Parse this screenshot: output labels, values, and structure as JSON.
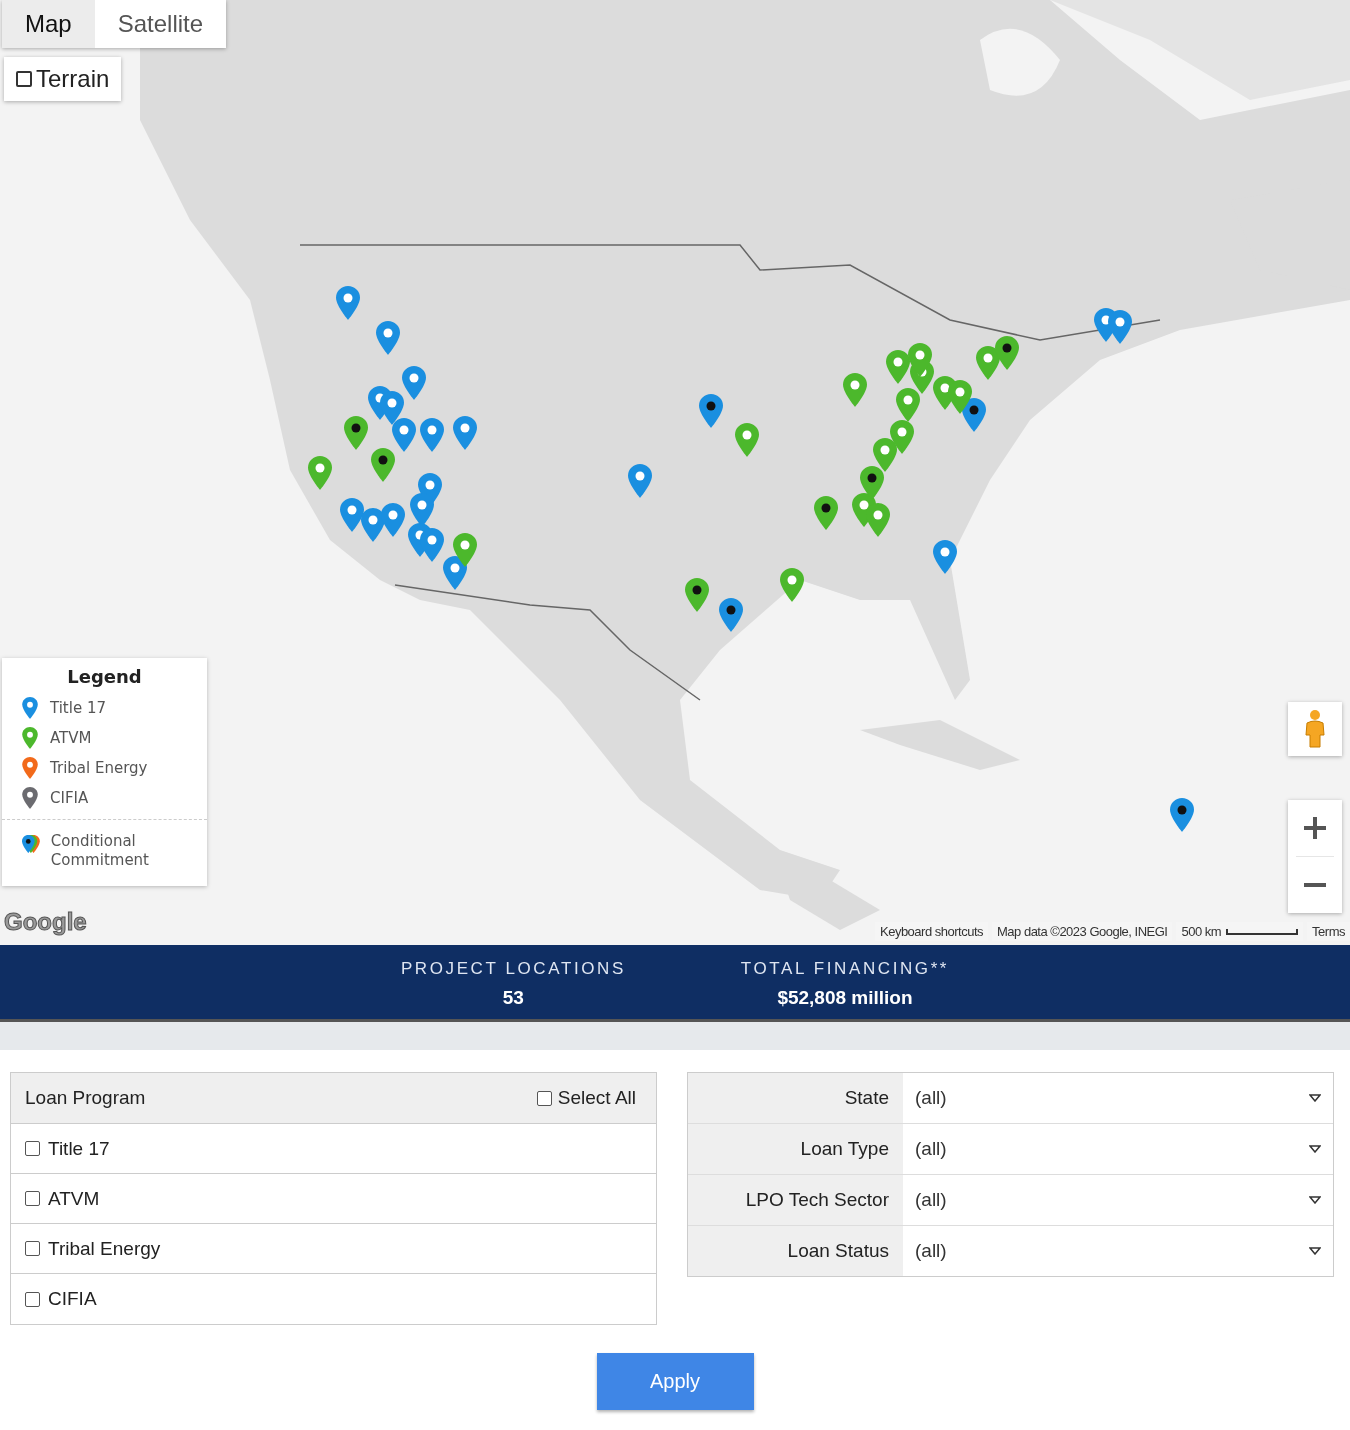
{
  "map": {
    "type_tabs": [
      {
        "label": "Map",
        "selected": true
      },
      {
        "label": "Satellite",
        "selected": false
      }
    ],
    "terrain": {
      "label": "Terrain",
      "checked": false
    },
    "legend": {
      "title": "Legend",
      "items": [
        {
          "label": "Title 17",
          "color": "#1a8fe0"
        },
        {
          "label": "ATVM",
          "color": "#4cb82c"
        },
        {
          "label": "Tribal Energy",
          "color": "#f26a1b"
        },
        {
          "label": "CIFIA",
          "color": "#6b6b70"
        }
      ],
      "conditional_label": "Conditional Commitment"
    },
    "markers": [
      {
        "kind": "title17",
        "conditional": false
      },
      {
        "kind": "title17",
        "conditional": false
      },
      {
        "kind": "title17",
        "conditional": false
      },
      {
        "kind": "title17",
        "conditional": false
      },
      {
        "kind": "title17",
        "conditional": false
      },
      {
        "kind": "title17",
        "conditional": false
      },
      {
        "kind": "title17",
        "conditional": false
      },
      {
        "kind": "title17",
        "conditional": false
      },
      {
        "kind": "title17",
        "conditional": false
      },
      {
        "kind": "title17",
        "conditional": false
      },
      {
        "kind": "title17",
        "conditional": false
      },
      {
        "kind": "title17",
        "conditional": false
      },
      {
        "kind": "title17",
        "conditional": false
      },
      {
        "kind": "title17",
        "conditional": false
      },
      {
        "kind": "title17",
        "conditional": false
      },
      {
        "kind": "title17",
        "conditional": false
      },
      {
        "kind": "title17",
        "conditional": false
      },
      {
        "kind": "title17",
        "conditional": false
      },
      {
        "kind": "title17",
        "conditional": false
      },
      {
        "kind": "title17",
        "conditional": false
      },
      {
        "kind": "title17",
        "conditional": true
      },
      {
        "kind": "title17",
        "conditional": true
      },
      {
        "kind": "title17",
        "conditional": true
      },
      {
        "kind": "title17",
        "conditional": true
      },
      {
        "kind": "atvm",
        "conditional": false
      },
      {
        "kind": "atvm",
        "conditional": false
      },
      {
        "kind": "atvm",
        "conditional": false
      },
      {
        "kind": "atvm",
        "conditional": false
      },
      {
        "kind": "atvm",
        "conditional": false
      },
      {
        "kind": "atvm",
        "conditional": false
      },
      {
        "kind": "atvm",
        "conditional": false
      },
      {
        "kind": "atvm",
        "conditional": false
      },
      {
        "kind": "atvm",
        "conditional": false
      },
      {
        "kind": "atvm",
        "conditional": false
      },
      {
        "kind": "atvm",
        "conditional": false
      },
      {
        "kind": "atvm",
        "conditional": false
      },
      {
        "kind": "atvm",
        "conditional": false
      },
      {
        "kind": "atvm",
        "conditional": false
      },
      {
        "kind": "atvm",
        "conditional": false
      },
      {
        "kind": "atvm",
        "conditional": false
      },
      {
        "kind": "atvm",
        "conditional": true
      },
      {
        "kind": "atvm",
        "conditional": true
      },
      {
        "kind": "atvm",
        "conditional": true
      },
      {
        "kind": "atvm",
        "conditional": true
      },
      {
        "kind": "atvm",
        "conditional": true
      },
      {
        "kind": "atvm",
        "conditional": true
      }
    ],
    "logo": "Google",
    "attribution": [
      "Keyboard shortcuts",
      "Map data ©2023 Google, INEGI"
    ],
    "scale": "500 km",
    "terms": "Terms"
  },
  "stats": [
    {
      "label": "PROJECT LOCATIONS",
      "value": "53"
    },
    {
      "label": "TOTAL FINANCING**",
      "value": "$52,808 million"
    }
  ],
  "loan_program": {
    "title": "Loan Program",
    "select_all": {
      "label": "Select All",
      "checked": false
    },
    "options": [
      {
        "label": "Title 17",
        "checked": false
      },
      {
        "label": "ATVM",
        "checked": false
      },
      {
        "label": "Tribal Energy",
        "checked": false
      },
      {
        "label": "CIFIA",
        "checked": false
      }
    ]
  },
  "filters": [
    {
      "label": "State",
      "value": "(all)"
    },
    {
      "label": "Loan Type",
      "value": "(all)"
    },
    {
      "label": "LPO Tech Sector",
      "value": "(all)"
    },
    {
      "label": "Loan Status",
      "value": "(all)"
    }
  ],
  "apply": "Apply"
}
